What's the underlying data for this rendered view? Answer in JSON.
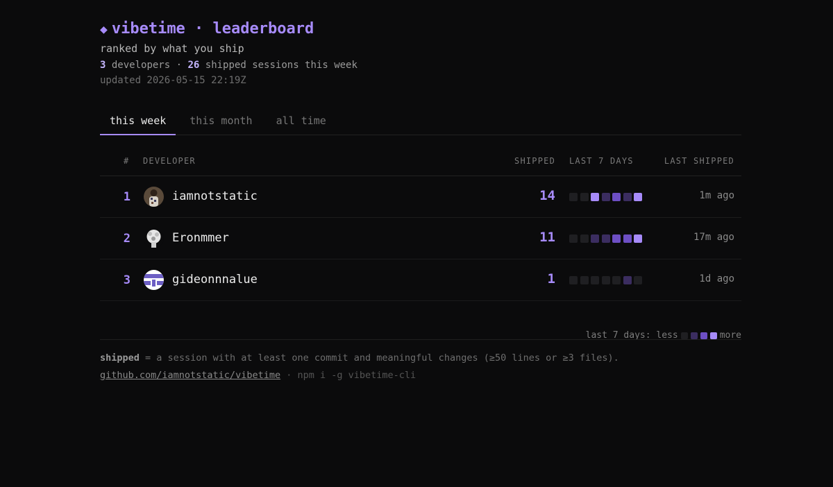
{
  "header": {
    "diamond": "◆",
    "title": "vibetime · leaderboard",
    "subtitle": "ranked by what you ship",
    "developers_count": "3",
    "developers_label": "developers ·",
    "sessions_count": "26",
    "sessions_label": "shipped sessions this week",
    "updated": "updated 2026-05-15 22:19Z"
  },
  "tabs": [
    {
      "label": "this week",
      "active": true
    },
    {
      "label": "this month",
      "active": false
    },
    {
      "label": "all time",
      "active": false
    }
  ],
  "table": {
    "headers": {
      "rank": "#",
      "developer": "DEVELOPER",
      "shipped": "SHIPPED",
      "last7": "LAST 7 DAYS",
      "last_shipped": "LAST SHIPPED"
    },
    "rows": [
      {
        "rank": "1",
        "name": "iamnotstatic",
        "shipped": "14",
        "days": [
          0,
          0,
          3,
          1,
          2,
          1,
          3
        ],
        "ago": "1m ago",
        "avatar": "photo"
      },
      {
        "rank": "2",
        "name": "Eronmmer",
        "shipped": "11",
        "days": [
          0,
          0,
          1,
          1,
          2,
          2,
          3
        ],
        "ago": "17m ago",
        "avatar": "sketch"
      },
      {
        "rank": "3",
        "name": "gideonnnalue",
        "shipped": "1",
        "days": [
          0,
          0,
          0,
          0,
          0,
          1,
          0
        ],
        "ago": "1d ago",
        "avatar": "pattern"
      }
    ]
  },
  "legend": {
    "label": "last 7 days: less",
    "more": "more"
  },
  "footer": {
    "term": "shipped",
    "definition": "= a session with at least one commit and meaningful changes (≥50 lines or ≥3 files).",
    "repo_link": "github.com/iamnotstatic/vibetime",
    "install": "· npm i -g vibetime-cli"
  },
  "colors": {
    "accent": "#a78bfa",
    "background": "#0b0b0c",
    "level1": "#3b2d60",
    "level2": "#6d4fc4",
    "level3": "#a78bfa",
    "empty": "#1f1f22"
  }
}
